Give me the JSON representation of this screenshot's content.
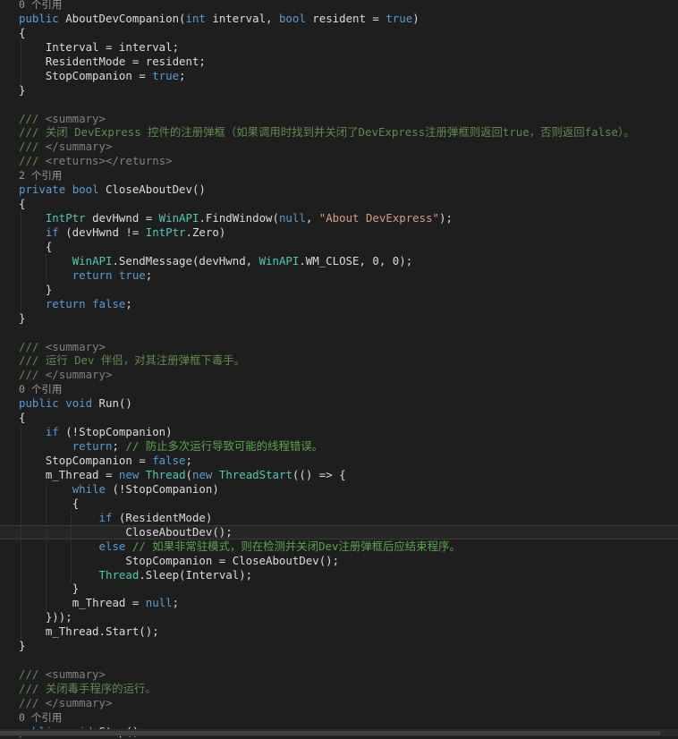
{
  "editor": {
    "current_line_index": 37,
    "lines": [
      {
        "kind": "lens",
        "text": "0 个引用"
      },
      {
        "kind": "code",
        "indent": 0,
        "tokens": [
          [
            "kw",
            "public"
          ],
          [
            "",
            " AboutDevCompanion("
          ],
          [
            "kw",
            "int"
          ],
          [
            "",
            " interval, "
          ],
          [
            "kw",
            "bool"
          ],
          [
            "",
            " resident = "
          ],
          [
            "kw",
            "true"
          ],
          [
            "",
            ")"
          ]
        ]
      },
      {
        "kind": "code",
        "indent": 0,
        "tokens": [
          [
            "",
            "{"
          ]
        ]
      },
      {
        "kind": "code",
        "indent": 4,
        "tokens": [
          [
            "",
            "Interval = interval;"
          ]
        ]
      },
      {
        "kind": "code",
        "indent": 4,
        "tokens": [
          [
            "",
            "ResidentMode = resident;"
          ]
        ]
      },
      {
        "kind": "code",
        "indent": 4,
        "tokens": [
          [
            "",
            "StopCompanion = "
          ],
          [
            "kw",
            "true"
          ],
          [
            "",
            ";"
          ]
        ]
      },
      {
        "kind": "code",
        "indent": 0,
        "tokens": [
          [
            "",
            "}"
          ]
        ]
      },
      {
        "kind": "code",
        "indent": 0,
        "tokens": []
      },
      {
        "kind": "code",
        "indent": 0,
        "tokens": [
          [
            "doc",
            "/// "
          ],
          [
            "tag",
            "<summary>"
          ]
        ]
      },
      {
        "kind": "code",
        "indent": 0,
        "tokens": [
          [
            "doc",
            "/// 关闭 DevExpress 控件的注册弹框（如果调用时找到并关闭了DevExpress注册弹框则返回true，否则返回false）。"
          ]
        ]
      },
      {
        "kind": "code",
        "indent": 0,
        "tokens": [
          [
            "doc",
            "/// "
          ],
          [
            "tag",
            "</summary>"
          ]
        ]
      },
      {
        "kind": "code",
        "indent": 0,
        "tokens": [
          [
            "doc",
            "/// "
          ],
          [
            "tag",
            "<returns></returns>"
          ]
        ]
      },
      {
        "kind": "lens",
        "text": "2 个引用"
      },
      {
        "kind": "code",
        "indent": 0,
        "tokens": [
          [
            "kw",
            "private"
          ],
          [
            "",
            " "
          ],
          [
            "kw",
            "bool"
          ],
          [
            "",
            " CloseAboutDev()"
          ]
        ]
      },
      {
        "kind": "code",
        "indent": 0,
        "tokens": [
          [
            "",
            "{"
          ]
        ]
      },
      {
        "kind": "code",
        "indent": 4,
        "tokens": [
          [
            "ty",
            "IntPtr"
          ],
          [
            "",
            " devHwnd = "
          ],
          [
            "ty",
            "WinAPI"
          ],
          [
            "",
            ".FindWindow("
          ],
          [
            "kw",
            "null"
          ],
          [
            "",
            ", "
          ],
          [
            "str",
            "\"About DevExpress\""
          ],
          [
            "",
            ");"
          ]
        ]
      },
      {
        "kind": "code",
        "indent": 4,
        "tokens": [
          [
            "kw",
            "if"
          ],
          [
            "",
            " (devHwnd != "
          ],
          [
            "ty",
            "IntPtr"
          ],
          [
            "",
            ".Zero)"
          ]
        ]
      },
      {
        "kind": "code",
        "indent": 4,
        "tokens": [
          [
            "",
            "{"
          ]
        ]
      },
      {
        "kind": "code",
        "indent": 8,
        "tokens": [
          [
            "ty",
            "WinAPI"
          ],
          [
            "",
            ".SendMessage(devHwnd, "
          ],
          [
            "ty",
            "WinAPI"
          ],
          [
            "",
            ".WM_CLOSE, 0, 0);"
          ]
        ]
      },
      {
        "kind": "code",
        "indent": 8,
        "tokens": [
          [
            "kw",
            "return"
          ],
          [
            "",
            " "
          ],
          [
            "kw",
            "true"
          ],
          [
            "",
            ";"
          ]
        ]
      },
      {
        "kind": "code",
        "indent": 4,
        "tokens": [
          [
            "",
            "}"
          ]
        ]
      },
      {
        "kind": "code",
        "indent": 4,
        "tokens": [
          [
            "kw",
            "return"
          ],
          [
            "",
            " "
          ],
          [
            "kw",
            "false"
          ],
          [
            "",
            ";"
          ]
        ]
      },
      {
        "kind": "code",
        "indent": 0,
        "tokens": [
          [
            "",
            "}"
          ]
        ]
      },
      {
        "kind": "code",
        "indent": 0,
        "tokens": []
      },
      {
        "kind": "code",
        "indent": 0,
        "tokens": [
          [
            "doc",
            "/// "
          ],
          [
            "tag",
            "<summary>"
          ]
        ]
      },
      {
        "kind": "code",
        "indent": 0,
        "tokens": [
          [
            "doc",
            "/// 运行 Dev 伴侣，对其注册弹框下毒手。"
          ]
        ]
      },
      {
        "kind": "code",
        "indent": 0,
        "tokens": [
          [
            "doc",
            "/// "
          ],
          [
            "tag",
            "</summary>"
          ]
        ]
      },
      {
        "kind": "lens",
        "text": "0 个引用"
      },
      {
        "kind": "code",
        "indent": 0,
        "tokens": [
          [
            "kw",
            "public"
          ],
          [
            "",
            " "
          ],
          [
            "kw",
            "void"
          ],
          [
            "",
            " Run()"
          ]
        ]
      },
      {
        "kind": "code",
        "indent": 0,
        "tokens": [
          [
            "",
            "{"
          ]
        ]
      },
      {
        "kind": "code",
        "indent": 4,
        "tokens": [
          [
            "kw",
            "if"
          ],
          [
            "",
            " (!StopCompanion)"
          ]
        ]
      },
      {
        "kind": "code",
        "indent": 8,
        "tokens": [
          [
            "kw",
            "return"
          ],
          [
            "",
            "; "
          ],
          [
            "cm",
            "// 防止多次运行导致可能的线程错误。"
          ]
        ]
      },
      {
        "kind": "code",
        "indent": 4,
        "tokens": [
          [
            "",
            "StopCompanion = "
          ],
          [
            "kw",
            "false"
          ],
          [
            "",
            ";"
          ]
        ]
      },
      {
        "kind": "code",
        "indent": 4,
        "tokens": [
          [
            "",
            "m_Thread = "
          ],
          [
            "kw",
            "new"
          ],
          [
            "",
            " "
          ],
          [
            "ty",
            "Thread"
          ],
          [
            "",
            "("
          ],
          [
            "kw",
            "new"
          ],
          [
            "",
            " "
          ],
          [
            "ty",
            "ThreadStart"
          ],
          [
            "",
            "(() => {"
          ]
        ]
      },
      {
        "kind": "code",
        "indent": 8,
        "tokens": [
          [
            "kw",
            "while"
          ],
          [
            "",
            " (!StopCompanion)"
          ]
        ]
      },
      {
        "kind": "code",
        "indent": 8,
        "tokens": [
          [
            "",
            "{"
          ]
        ]
      },
      {
        "kind": "code",
        "indent": 12,
        "tokens": [
          [
            "kw",
            "if"
          ],
          [
            "",
            " (ResidentMode)"
          ]
        ]
      },
      {
        "kind": "code",
        "indent": 16,
        "tokens": [
          [
            "",
            "CloseAboutDev();"
          ]
        ]
      },
      {
        "kind": "code",
        "indent": 12,
        "tokens": [
          [
            "kw",
            "else"
          ],
          [
            "",
            " "
          ],
          [
            "cm",
            "// 如果非常驻模式，则在检测并关闭Dev注册弹框后应结束程序。"
          ]
        ]
      },
      {
        "kind": "code",
        "indent": 16,
        "tokens": [
          [
            "",
            "StopCompanion = CloseAboutDev();"
          ]
        ]
      },
      {
        "kind": "code",
        "indent": 12,
        "tokens": [
          [
            "ty",
            "Thread"
          ],
          [
            "",
            ".Sleep(Interval);"
          ]
        ]
      },
      {
        "kind": "code",
        "indent": 8,
        "tokens": [
          [
            "",
            "}"
          ]
        ]
      },
      {
        "kind": "code",
        "indent": 8,
        "tokens": [
          [
            "",
            "m_Thread = "
          ],
          [
            "kw",
            "null"
          ],
          [
            "",
            ";"
          ]
        ]
      },
      {
        "kind": "code",
        "indent": 4,
        "tokens": [
          [
            "",
            "}));"
          ]
        ]
      },
      {
        "kind": "code",
        "indent": 4,
        "tokens": [
          [
            "",
            "m_Thread.Start();"
          ]
        ]
      },
      {
        "kind": "code",
        "indent": 0,
        "tokens": [
          [
            "",
            "}"
          ]
        ]
      },
      {
        "kind": "code",
        "indent": 0,
        "tokens": []
      },
      {
        "kind": "code",
        "indent": 0,
        "tokens": [
          [
            "doc",
            "/// "
          ],
          [
            "tag",
            "<summary>"
          ]
        ]
      },
      {
        "kind": "code",
        "indent": 0,
        "tokens": [
          [
            "doc",
            "/// 关闭毒手程序的运行。"
          ]
        ]
      },
      {
        "kind": "code",
        "indent": 0,
        "tokens": [
          [
            "doc",
            "/// "
          ],
          [
            "tag",
            "</summary>"
          ]
        ]
      },
      {
        "kind": "lens",
        "text": "0 个引用"
      },
      {
        "kind": "code",
        "indent": 0,
        "tokens": [
          [
            "kw",
            "public"
          ],
          [
            "",
            " "
          ],
          [
            "kw",
            "void"
          ],
          [
            "",
            " Stop()"
          ]
        ]
      }
    ]
  },
  "colors": {
    "background": "#1e1e1e",
    "text": "#dcdcdc",
    "keyword": "#569cd6",
    "type": "#4ec9b0",
    "string": "#d69d85",
    "comment": "#57a64a",
    "doc_comment": "#608b4e",
    "xml_tag": "#808080",
    "codelens": "#999999"
  }
}
